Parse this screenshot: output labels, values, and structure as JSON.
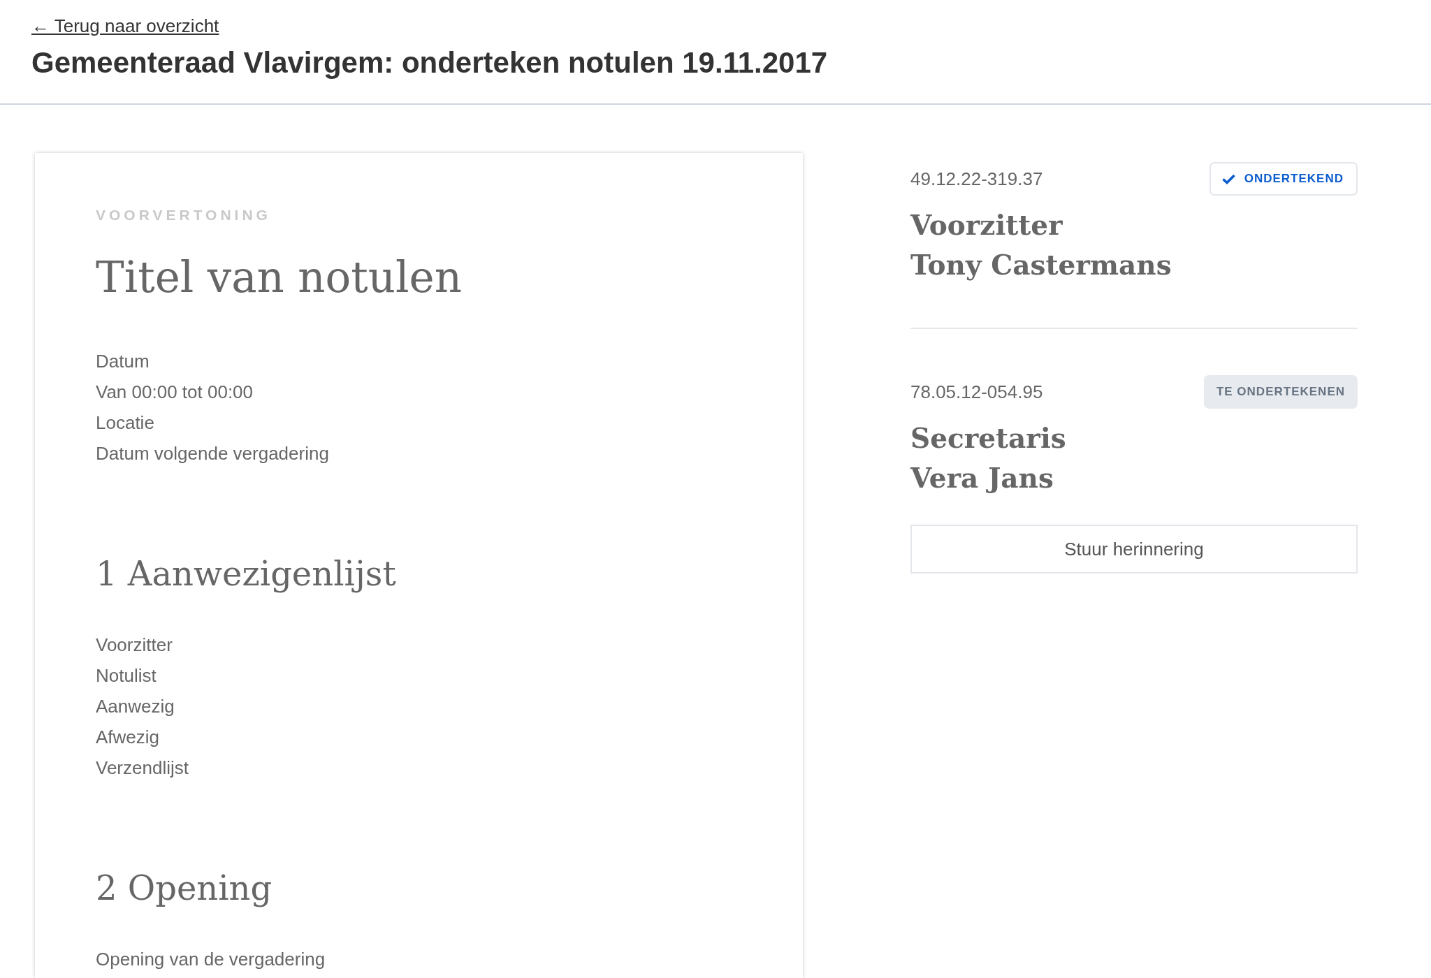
{
  "back_link": "← Terug naar overzicht",
  "title": "Gemeenteraad Vlavirgem: onderteken notulen 19.11.2017",
  "preview": {
    "label": "VOORVERTONING",
    "title": "Titel van notulen",
    "meta": [
      "Datum",
      "Van 00:00 tot 00:00",
      "Locatie",
      "Datum volgende vergadering"
    ],
    "sections": [
      {
        "heading": "1 Aanwezigenlijst",
        "lines": [
          "Voorzitter",
          "Notulist",
          "Aanwezig",
          "Afwezig",
          "Verzendlijst"
        ]
      },
      {
        "heading": "2 Opening",
        "lines": [
          "Opening van de vergadering"
        ]
      }
    ]
  },
  "signers": [
    {
      "id": "49.12.22-319.37",
      "status": "ONDERTEKEND",
      "signed": true,
      "role": "Voorzitter",
      "name": "Tony Castermans"
    },
    {
      "id": "78.05.12-054.95",
      "status": "TE ONDERTEKENEN",
      "signed": false,
      "role": "Secretaris",
      "name": "Vera Jans",
      "action": "Stuur herinnering"
    }
  ]
}
